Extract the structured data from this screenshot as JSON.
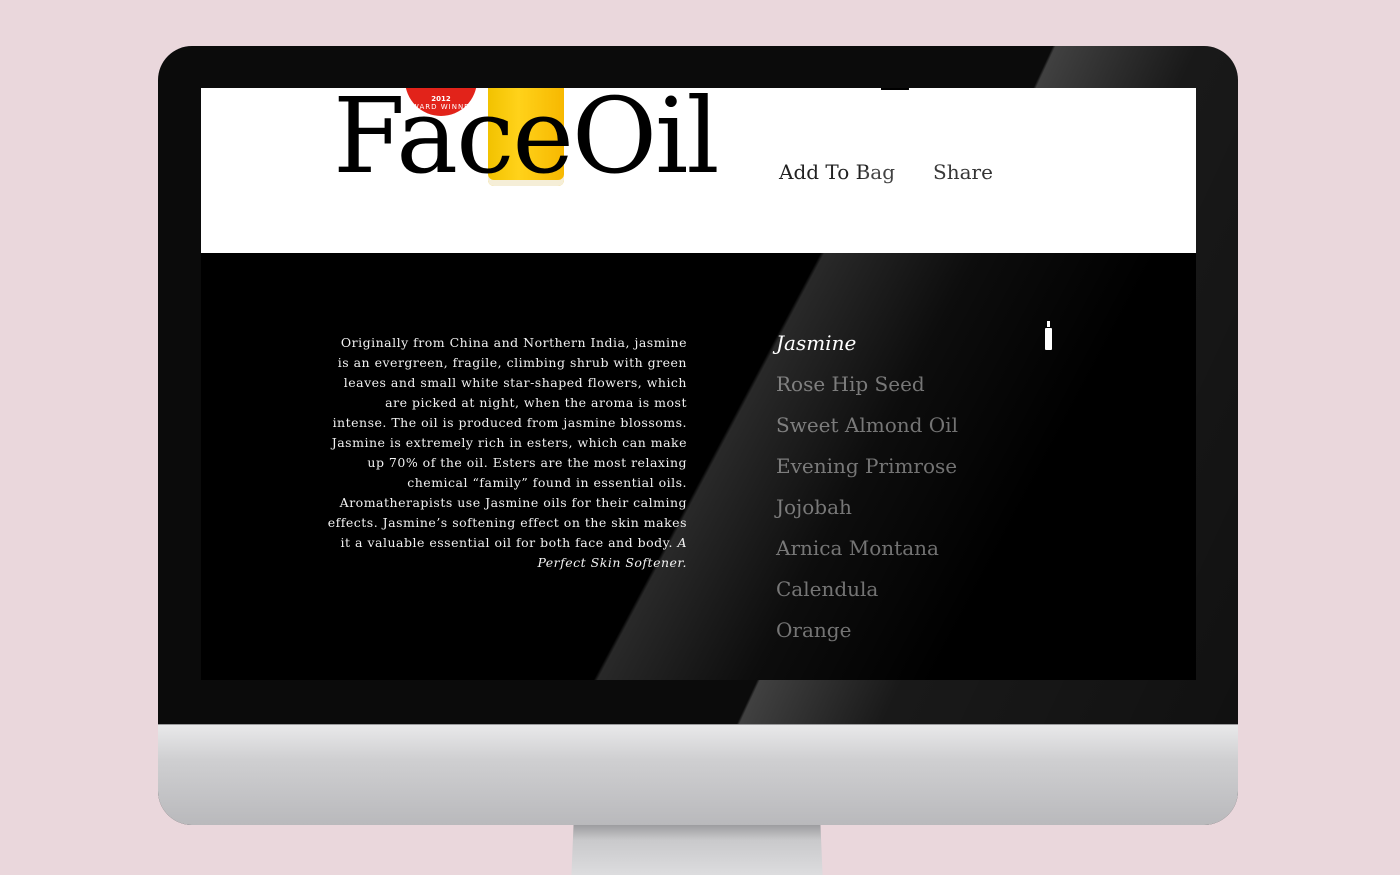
{
  "header": {
    "title": "FaceOil",
    "badge": {
      "year": "2012",
      "text": "AWARD WINNER"
    },
    "nav": {
      "add_to_bag": "Add To Bag",
      "share": "Share"
    }
  },
  "description": {
    "text": "Originally from China and Northern India, jasmine is an evergreen, fragile, climbing shrub with green leaves and small white star-shaped flowers, which are picked at night, when the aroma is most intense. The oil is produced from jasmine blossoms. Jasmine is extremely rich in esters, which can make up 70% of the oil. Esters are the most relaxing chemical “family” found in essential oils. Aromatherapists use Jasmine oils for their calming effects. Jasmine’s softening effect on the skin makes it a valuable essential oil for both face and body.",
    "tagline": "A Perfect Skin Softener."
  },
  "ingredients": {
    "active": "Jasmine",
    "items": [
      {
        "label": "Jasmine"
      },
      {
        "label": "Rose Hip Seed"
      },
      {
        "label": "Sweet Almond Oil"
      },
      {
        "label": "Evening Primrose"
      },
      {
        "label": "Jojobah"
      },
      {
        "label": "Arnica Montana"
      },
      {
        "label": "Calendula"
      },
      {
        "label": "Orange"
      }
    ]
  },
  "icons": {
    "bottle": "bottle-icon",
    "award": "award-badge"
  },
  "colors": {
    "background": "#ead7dc",
    "bottle_yellow": "#ffd21a",
    "badge_red": "#e2231a",
    "inactive_text": "#6e6e6e"
  }
}
